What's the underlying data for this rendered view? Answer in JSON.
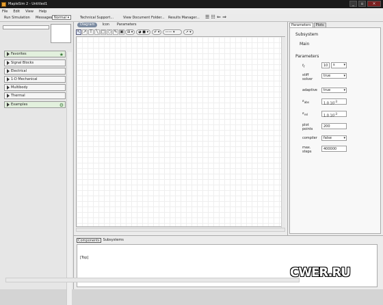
{
  "window": {
    "title": "MapleSim 2 - Untitled1",
    "controls": [
      "_",
      "▫",
      "×"
    ]
  },
  "menu": {
    "items": [
      "File",
      "Edit",
      "View",
      "Help"
    ]
  },
  "toolbar1": {
    "run_simulation": "Run Simulation",
    "messages_label": "Messages :",
    "messages_value": "Normal",
    "technical_support": "Technical Support...",
    "view_document_folder": "View Document Folder...",
    "results_manager": "Results Manager..."
  },
  "palettes": [
    {
      "label": "Favorites",
      "icon": "star-icon"
    },
    {
      "label": "Signal Blocks"
    },
    {
      "label": "Electrical"
    },
    {
      "label": "1-D Mechanical"
    },
    {
      "label": "Multibody"
    },
    {
      "label": "Thermal"
    },
    {
      "label": "Examples",
      "icon": "examples-icon"
    }
  ],
  "center_tabs": [
    "Diagram",
    "Icon",
    "Parameters"
  ],
  "right_tabs": [
    "Parameters",
    "Plots"
  ],
  "subsystem": {
    "heading": "Subsystem",
    "name": "Main"
  },
  "parameters": {
    "heading": "Parameters",
    "t_f": {
      "label": "t",
      "sub": "f",
      "value": "10",
      "unit": "s"
    },
    "stiff_solver": {
      "label": "stiff solver",
      "value": "true"
    },
    "adaptive": {
      "label": "adaptive",
      "value": "true"
    },
    "eps_abs": {
      "label": "ε",
      "sub": "abs",
      "value": "1.0 10",
      "exp": "-3"
    },
    "eps_rel": {
      "label": "ε",
      "sub": "rel",
      "value": "1.0 10",
      "exp": "-3"
    },
    "plot_points": {
      "label": "plot points",
      "value": "200"
    },
    "compiler": {
      "label": "compiler",
      "value": "false"
    },
    "max_steps": {
      "label": "max. steps",
      "value": "400000"
    }
  },
  "bottom": {
    "tabs": [
      "Components",
      "Subsystems"
    ],
    "content": "[Top]"
  },
  "watermark": "CWER.RU",
  "colors": {
    "titlebar": "#1a1a1a",
    "canvas": "#ffffff",
    "tab_active": "#7a8aa0",
    "palette_green": "#e2f0dd"
  }
}
